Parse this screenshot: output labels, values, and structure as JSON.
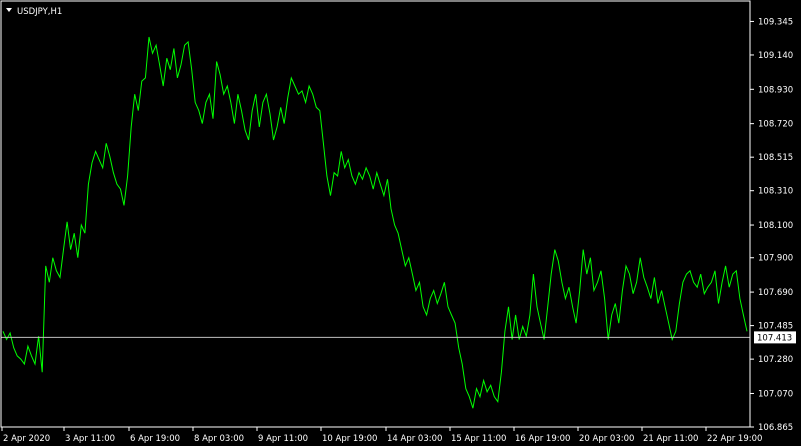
{
  "window": {
    "symbol_label": "USDJPY,H1"
  },
  "current_price": {
    "value": 107.413,
    "label": "107.413"
  },
  "colors": {
    "background": "#000000",
    "price_line": "#00ff00",
    "axis": "#ffffff",
    "bid_line": "#c0c0c0",
    "price_tag_bg": "#ffffff",
    "price_tag_text": "#000000"
  },
  "chart_data": {
    "type": "line",
    "ylim": [
      106.865,
      109.47
    ],
    "y_ticks": [
      "109.345",
      "109.140",
      "108.930",
      "108.720",
      "108.515",
      "108.310",
      "108.100",
      "107.900",
      "107.690",
      "107.485",
      "107.280",
      "107.070",
      "106.865"
    ],
    "x_ticks": [
      "2 Apr 2020",
      "3 Apr 11:00",
      "6 Apr 19:00",
      "8 Apr 03:00",
      "9 Apr 11:00",
      "10 Apr 19:00",
      "14 Apr 03:00",
      "15 Apr 11:00",
      "16 Apr 19:00",
      "20 Apr 03:00",
      "21 Apr 11:00",
      "22 Apr 19:00"
    ],
    "series": [
      {
        "values": [
          107.45,
          107.4,
          107.44,
          107.35,
          107.3,
          107.28,
          107.25,
          107.36,
          107.3,
          107.25,
          107.42,
          107.2,
          107.85,
          107.75,
          107.9,
          107.82,
          107.78,
          107.95,
          108.12,
          107.95,
          108.05,
          107.9,
          108.1,
          108.05,
          108.35,
          108.48,
          108.55,
          108.5,
          108.45,
          108.6,
          108.52,
          108.42,
          108.35,
          108.32,
          108.22,
          108.4,
          108.7,
          108.9,
          108.8,
          108.98,
          109.0,
          109.25,
          109.15,
          109.2,
          109.08,
          108.95,
          109.12,
          109.05,
          109.18,
          109.0,
          109.08,
          109.2,
          109.22,
          109.05,
          108.85,
          108.8,
          108.72,
          108.85,
          108.9,
          108.75,
          109.1,
          109.02,
          108.9,
          108.95,
          108.85,
          108.72,
          108.9,
          108.8,
          108.68,
          108.62,
          108.8,
          108.9,
          108.7,
          108.85,
          108.9,
          108.78,
          108.62,
          108.7,
          108.82,
          108.72,
          108.88,
          109.0,
          108.95,
          108.9,
          108.92,
          108.85,
          108.95,
          108.9,
          108.82,
          108.8,
          108.6,
          108.4,
          108.28,
          108.42,
          108.4,
          108.55,
          108.45,
          108.5,
          108.4,
          108.35,
          108.42,
          108.38,
          108.45,
          108.4,
          108.32,
          108.42,
          108.35,
          108.28,
          108.38,
          108.2,
          108.1,
          108.05,
          107.95,
          107.85,
          107.9,
          107.8,
          107.7,
          107.75,
          107.6,
          107.55,
          107.65,
          107.7,
          107.62,
          107.68,
          107.75,
          107.6,
          107.55,
          107.5,
          107.35,
          107.25,
          107.1,
          107.05,
          106.98,
          107.1,
          107.05,
          107.15,
          107.08,
          107.12,
          107.05,
          107.02,
          107.2,
          107.45,
          107.6,
          107.4,
          107.55,
          107.4,
          107.48,
          107.42,
          107.55,
          107.8,
          107.6,
          107.5,
          107.4,
          107.6,
          107.8,
          107.95,
          107.88,
          107.75,
          107.65,
          107.72,
          107.6,
          107.5,
          107.7,
          107.95,
          107.8,
          107.9,
          107.7,
          107.75,
          107.82,
          107.65,
          107.4,
          107.55,
          107.62,
          107.5,
          107.7,
          107.85,
          107.8,
          107.68,
          107.75,
          107.9,
          107.78,
          107.72,
          107.65,
          107.78,
          107.62,
          107.7,
          107.6,
          107.5,
          107.4,
          107.45,
          107.62,
          107.75,
          107.8,
          107.82,
          107.75,
          107.72,
          107.8,
          107.68,
          107.72,
          107.75,
          107.82,
          107.62,
          107.75,
          107.85,
          107.72,
          107.8,
          107.82,
          107.65,
          107.55,
          107.45
        ]
      }
    ]
  }
}
